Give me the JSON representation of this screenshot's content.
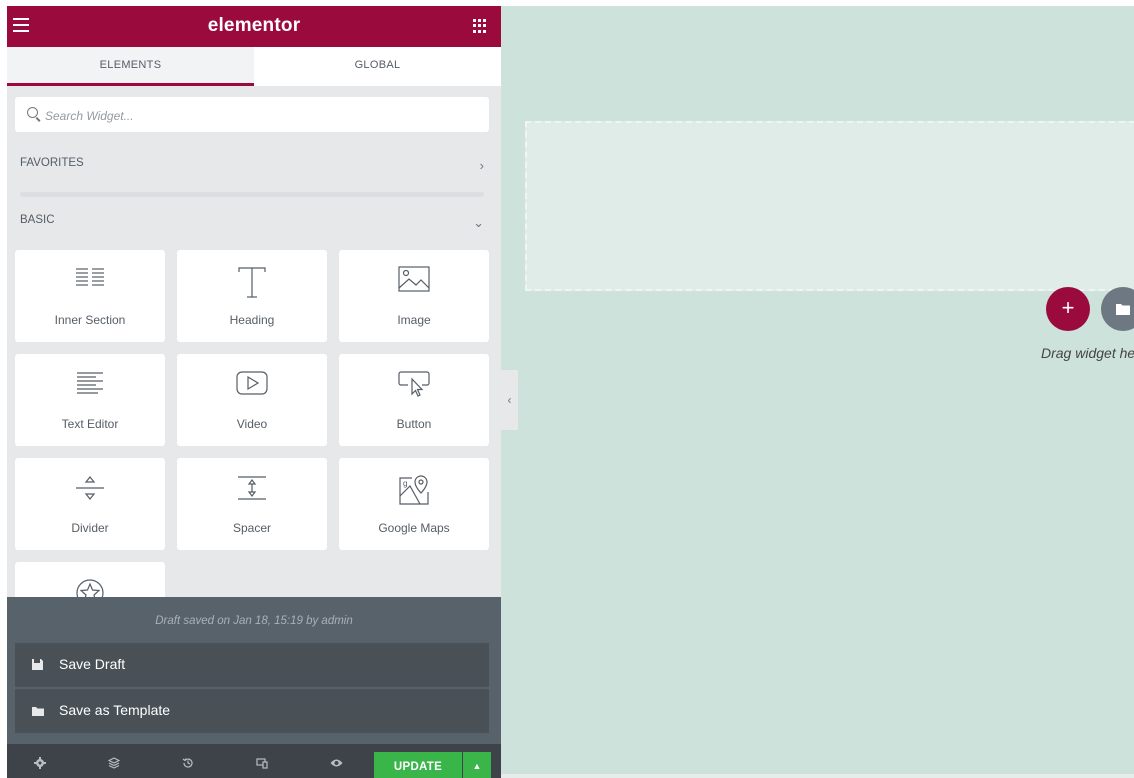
{
  "header": {
    "logo_text": "elementor",
    "brand_color": "#9b0a3d",
    "menu_icon": "hamburger-icon",
    "apps_icon": "grid-icon"
  },
  "tabs": [
    {
      "label": "ELEMENTS",
      "active": true
    },
    {
      "label": "GLOBAL",
      "active": false
    }
  ],
  "search": {
    "placeholder": "Search Widget...",
    "value": ""
  },
  "categories": {
    "favorites": "FAVORITES",
    "basic": "BASIC"
  },
  "widgets": [
    {
      "label": "Inner Section",
      "icon": "inner-section-icon"
    },
    {
      "label": "Heading",
      "icon": "heading-icon"
    },
    {
      "label": "Image",
      "icon": "image-icon"
    },
    {
      "label": "Text Editor",
      "icon": "text-editor-icon"
    },
    {
      "label": "Video",
      "icon": "video-icon"
    },
    {
      "label": "Button",
      "icon": "button-icon"
    },
    {
      "label": "Divider",
      "icon": "divider-icon"
    },
    {
      "label": "Spacer",
      "icon": "spacer-icon"
    },
    {
      "label": "Google Maps",
      "icon": "google-maps-icon"
    },
    {
      "label": "",
      "icon": "star-icon"
    }
  ],
  "save_menu": {
    "status": "Draft saved on Jan 18, 15:19 by admin",
    "items": [
      {
        "label": "Save Draft",
        "icon": "save-icon"
      },
      {
        "label": "Save as Template",
        "icon": "folder-icon"
      }
    ]
  },
  "toolbar": {
    "icons": [
      "settings-icon",
      "navigator-icon",
      "history-icon",
      "responsive-icon",
      "preview-icon"
    ],
    "update_label": "UPDATE",
    "update_color": "#39b54a"
  },
  "canvas": {
    "background": "#cde2da",
    "drop_label": "Drag widget here"
  }
}
